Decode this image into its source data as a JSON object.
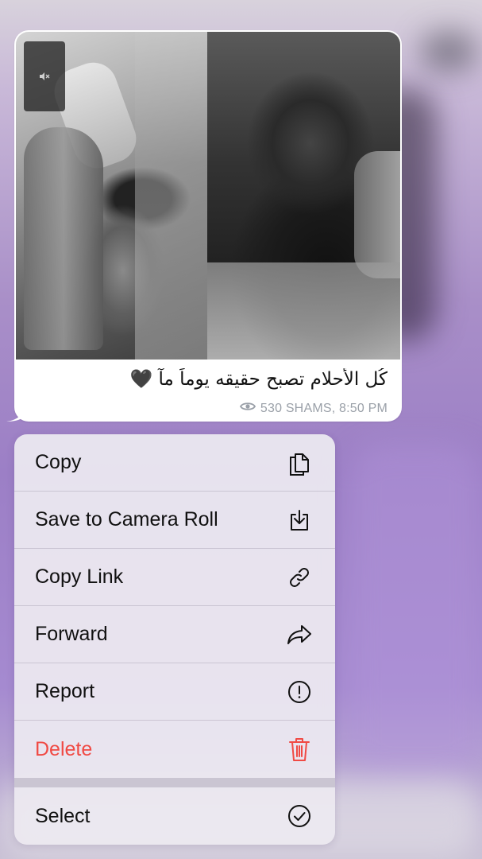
{
  "message": {
    "caption": "كُل الأحلام تصبح حقيقه يوماً مآ 🖤",
    "views": "530",
    "author": "SHAMS",
    "time": "8:50 PM",
    "meta_text": "530 SHAMS, 8:50 PM"
  },
  "menu": {
    "items": [
      {
        "label": "Copy",
        "icon": "copy-icon"
      },
      {
        "label": "Save to Camera Roll",
        "icon": "save-download-icon"
      },
      {
        "label": "Copy Link",
        "icon": "link-icon"
      },
      {
        "label": "Forward",
        "icon": "forward-arrow-icon"
      },
      {
        "label": "Report",
        "icon": "report-exclamation-icon"
      },
      {
        "label": "Delete",
        "icon": "trash-icon",
        "color": "#f04a44"
      },
      {
        "label": "Select",
        "icon": "checkmark-circle-icon"
      }
    ]
  }
}
